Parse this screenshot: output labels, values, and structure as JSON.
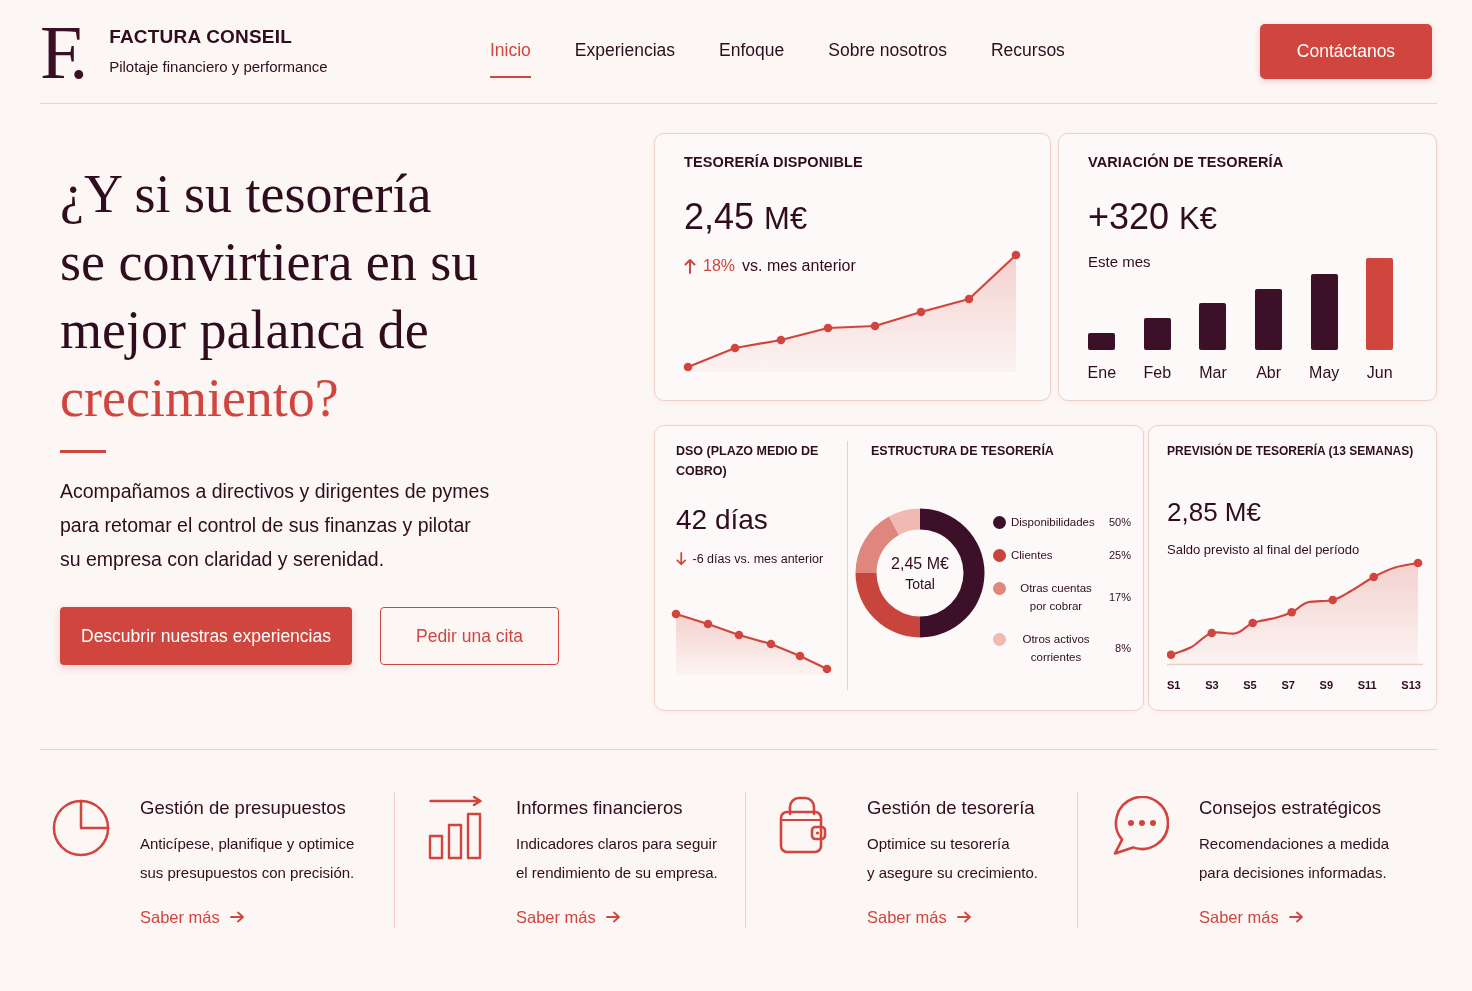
{
  "header": {
    "logo_mark": "F.",
    "brand": "FACTURA CONSEIL",
    "tagline": "Pilotaje financiero y performance",
    "nav": [
      {
        "label": "Inicio",
        "selected": true
      },
      {
        "label": "Experiencias",
        "selected": false
      },
      {
        "label": "Enfoque",
        "selected": false
      },
      {
        "label": "Sobre nosotros",
        "selected": false
      },
      {
        "label": "Recursos",
        "selected": false
      }
    ],
    "cta": "Contáctanos"
  },
  "hero": {
    "title_lines": [
      "¿Y si su tesorería",
      "se convirtiera en su",
      "mejor palanca de"
    ],
    "title_accent": "crecimiento?",
    "text_lines": [
      "Acompañamos a directivos y dirigentes de pymes",
      "para retomar el control de sus finanzas y pilotar",
      "su empresa con claridad y serenidad."
    ],
    "primary_button": "Descubrir nuestras experiencias",
    "secondary_button": "Pedir una cita"
  },
  "treasury_card": {
    "title": "TESORERÍA DISPONIBLE",
    "value": "2,45",
    "unit": "M€",
    "rising": true,
    "change": "18%",
    "change_note": "vs. mes anterior"
  },
  "variation_card": {
    "title": "VARIACIÓN DE TESORERÍA",
    "value": "+320",
    "unit": "K€",
    "subtitle": "Este mes",
    "bars": [
      {
        "label": "Ene",
        "highlight": false
      },
      {
        "label": "Feb",
        "highlight": false
      },
      {
        "label": "Mar",
        "highlight": false
      },
      {
        "label": "Abr",
        "highlight": false
      },
      {
        "label": "May",
        "highlight": false
      },
      {
        "label": "Jun",
        "highlight": true
      }
    ]
  },
  "dso_card": {
    "title": "DSO (PLAZO MEDIO DE COBRO)",
    "value": "42 días",
    "rising": false,
    "change": "-6 días vs. mes anterior"
  },
  "structure_card": {
    "title": "ESTRUCTURA DE TESORERÍA",
    "center_value": "2,45 M€",
    "center_label": "Total",
    "chart_data": {
      "type": "donut",
      "legend": "right",
      "categories": [
        "Disponibilidades",
        "Clientes",
        "Otras cuentas por cobrar",
        "Otros activos corrientes"
      ],
      "values": [
        50,
        25,
        17,
        8
      ]
    },
    "slices": [
      {
        "value": "50%",
        "color": "#3b1028"
      },
      {
        "value": "25%",
        "color": "#c8453d"
      },
      {
        "value": "17%",
        "color": "#e0877d"
      },
      {
        "value": "8%",
        "color": "#f0b9b1"
      }
    ]
  },
  "forecast_card": {
    "title": "PREVISIÓN DE TESORERÍA (13 SEMANAS)",
    "value": "2,85 M€",
    "subtitle": "Saldo previsto al final del período",
    "x_labels": [
      "S1",
      "S3",
      "S5",
      "S7",
      "S9",
      "S11",
      "S13"
    ]
  },
  "services": [
    {
      "kind": "pie",
      "title": "Gestión de presupuestos",
      "text_lines": [
        "Anticípese, planifique y optimice",
        "sus presupuestos con precisión."
      ],
      "link": "Saber más"
    },
    {
      "kind": "bars",
      "title": "Informes financieros",
      "text_lines": [
        "Indicadores claros para seguir",
        "el rendimiento de su empresa."
      ],
      "link": "Saber más"
    },
    {
      "kind": "wallet",
      "title": "Gestión de tesorería",
      "text_lines": [
        "Optimice su tesorería",
        "y asegure su crecimiento."
      ],
      "link": "Saber más"
    },
    {
      "kind": "chat",
      "title": "Consejos estratégicos",
      "text_lines": [
        "Recomendaciones a medida",
        "para decisiones informadas."
      ],
      "link": "Saber más"
    }
  ]
}
